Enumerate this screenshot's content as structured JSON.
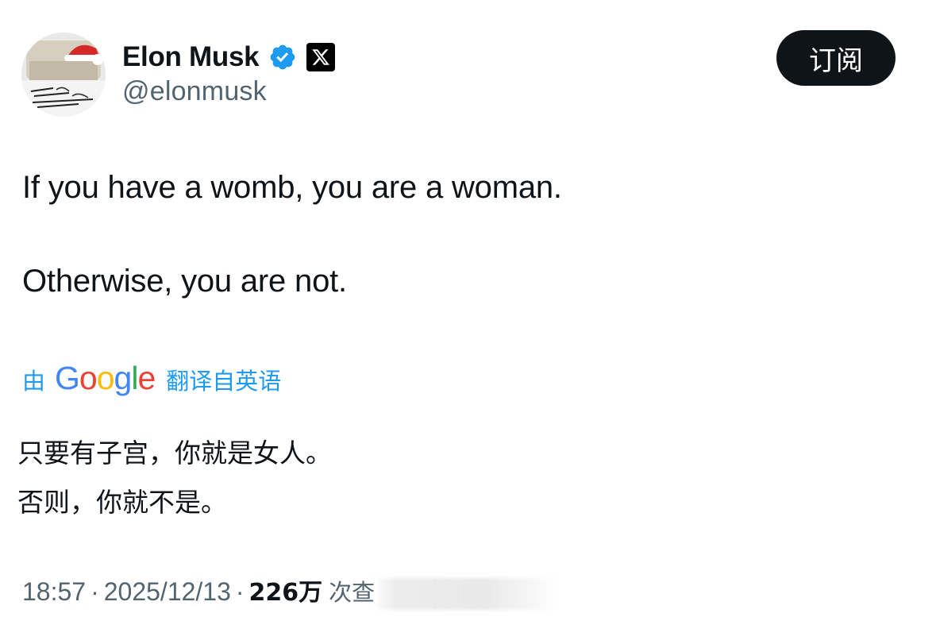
{
  "header": {
    "display_name": "Elon Musk",
    "handle": "@elonmusk",
    "subscribe_label": "订阅",
    "avatar_icon": "avatar-santa-hat",
    "verified_icon": "verified-badge-icon",
    "affiliate_icon": "x-logo-icon",
    "verified_color": "#1d9bf0"
  },
  "tweet": {
    "line1": "If you have a womb, you are a woman.",
    "line2": "Otherwise, you are not."
  },
  "translation": {
    "prefix": "由",
    "provider": "Google",
    "suffix": "翻译自英语",
    "line1": "只要有子宫，你就是女人。",
    "line2": "否则，你就不是。"
  },
  "meta": {
    "time": "18:57",
    "separator": "·",
    "date": "2025/12/13",
    "views": "226万",
    "views_label": "次查"
  }
}
